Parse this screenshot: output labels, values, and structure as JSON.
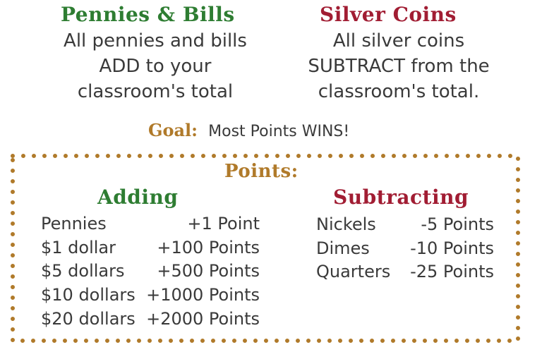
{
  "pennies_bills": {
    "heading": "Pennies & Bills",
    "lines": [
      "All pennies and bills",
      "ADD to your",
      "classroom's total"
    ]
  },
  "silver_coins": {
    "heading": "Silver Coins",
    "lines": [
      "All silver coins",
      "SUBTRACT from the",
      "classroom's total."
    ]
  },
  "goal": {
    "label": "Goal:",
    "text": "Most Points WINS!"
  },
  "points": {
    "heading": "Points:",
    "adding": {
      "heading": "Adding",
      "rows": [
        {
          "item": "Pennies",
          "points": "+1 Point"
        },
        {
          "item": "$1 dollar",
          "points": "+100 Points"
        },
        {
          "item": "$5 dollars",
          "points": "+500 Points"
        },
        {
          "item": "$10 dollars",
          "points": "+1000 Points"
        },
        {
          "item": "$20 dollars",
          "points": "+2000 Points"
        }
      ]
    },
    "subtracting": {
      "heading": "Subtracting",
      "rows": [
        {
          "item": "Nickels",
          "points": "-5 Points"
        },
        {
          "item": "Dimes",
          "points": "-10 Points"
        },
        {
          "item": "Quarters",
          "points": "-25 Points"
        }
      ]
    }
  },
  "colors": {
    "green": "#2e7d32",
    "red": "#a11d33",
    "gold": "#b07a2a",
    "text": "#3a3a3a"
  }
}
